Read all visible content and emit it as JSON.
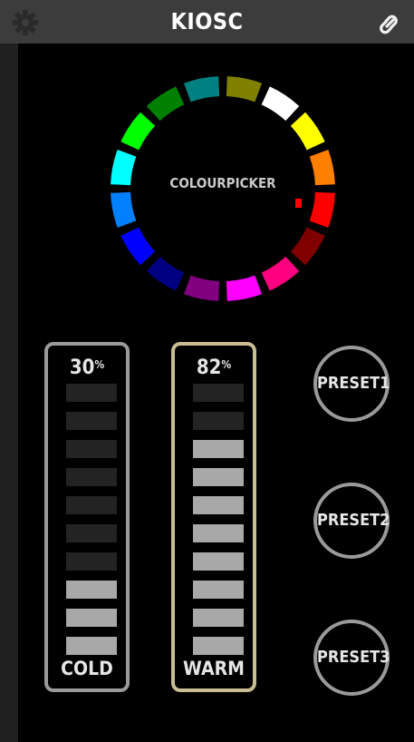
{
  "header": {
    "title": "KIOSC"
  },
  "colorpicker": {
    "label": "COLOURPICKER",
    "segments": [
      "#808000",
      "#ffffff",
      "#ffff00",
      "#ff8000",
      "#ff0000",
      "#800000",
      "#ff0080",
      "#ff00ff",
      "#800080",
      "#000080",
      "#0000ff",
      "#0080ff",
      "#00ffff",
      "#00ff00",
      "#008000",
      "#008080"
    ],
    "marker_color": "#ff0000"
  },
  "faders": [
    {
      "id": "cold",
      "label": "COLD",
      "value": "30",
      "unit": "%",
      "level": 0.3,
      "border_color": "#9a9a9a"
    },
    {
      "id": "warm",
      "label": "WARM",
      "value": "82",
      "unit": "%",
      "level": 0.82,
      "border_color": "#c8bd93"
    }
  ],
  "presets": [
    {
      "label": "PRESET1"
    },
    {
      "label": "PRESET2"
    },
    {
      "label": "PRESET3"
    }
  ],
  "colors": {
    "segment_on": "#a8a8a8",
    "segment_off": "#232323"
  }
}
